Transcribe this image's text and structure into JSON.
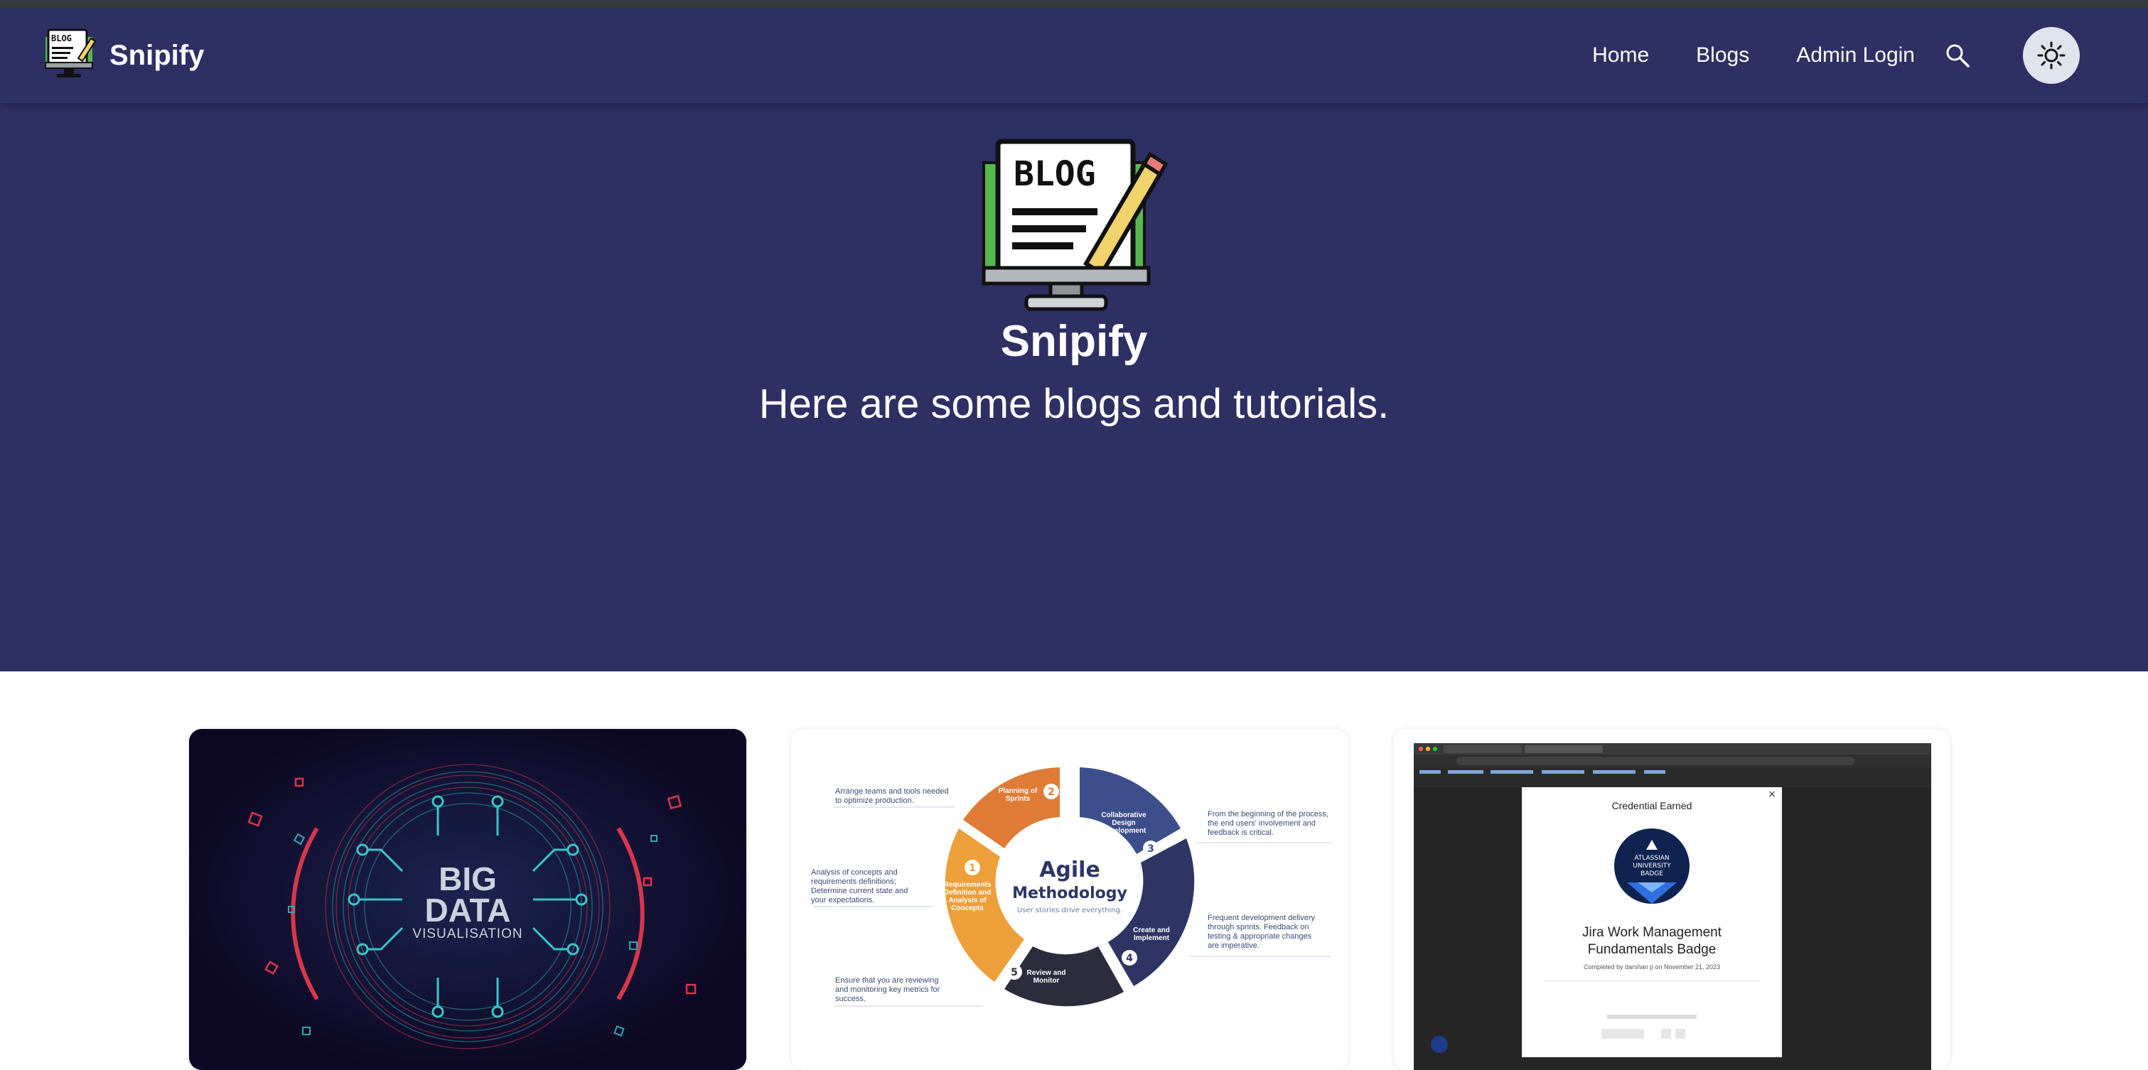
{
  "brand": {
    "name": "Snipify",
    "logo_icon": "blog-monitor-icon",
    "logo_text": "BLOG"
  },
  "nav": {
    "items": [
      {
        "label": "Home"
      },
      {
        "label": "Blogs"
      },
      {
        "label": "Admin Login"
      }
    ],
    "search_icon": "search-icon",
    "theme_toggle_icon": "sun-icon"
  },
  "hero": {
    "title": "Snipify",
    "subtitle": "Here are some blogs and tutorials.",
    "logo_text": "BLOG"
  },
  "cards": [
    {
      "image": "big-data-visualisation",
      "title_line1": "BIG",
      "title_line2": "DATA",
      "caption": "VISUALISATION"
    },
    {
      "image": "agile-methodology-diagram",
      "center_title_1": "Agile",
      "center_title_2": "Methodology",
      "center_sub": "User stories drive everything.",
      "steps": [
        {
          "num": "1",
          "label": "Requirements Definition and Analysis of Concepts"
        },
        {
          "num": "2",
          "label": "Planning of Sprints"
        },
        {
          "num": "3",
          "label": "Collaborative Design Development"
        },
        {
          "num": "4",
          "label": "Create and Implement"
        },
        {
          "num": "5",
          "label": "Review and Monitor"
        }
      ],
      "notes": [
        "Arrange teams and tools needed to optimize production.",
        "Analysis of concepts and requirements definitions; Determine current state and your expectations.",
        "Ensure that you are reviewing and monitoring key metrics for success.",
        "From the beginning of the process, the end users' involvement and feedback is critical.",
        "Frequent development delivery through sprints. Feedback on testing & appropriate changes are imperative."
      ]
    },
    {
      "image": "jira-credential-screenshot",
      "modal_heading": "Credential Earned",
      "badge_text_1": "ATLASSIAN",
      "badge_text_2": "UNIVERSITY",
      "badge_text_3": "BADGE",
      "badge_title_1": "Jira Work Management",
      "badge_title_2": "Fundamentals Badge",
      "completed_by": "Completed by darshan p on November 21, 2023"
    }
  ],
  "colors": {
    "navbar_bg": "#2e2f63",
    "hero_bg": "#2e2f63",
    "page_bg": "#ffffff",
    "theme_button_bg": "#dfe3ec"
  }
}
